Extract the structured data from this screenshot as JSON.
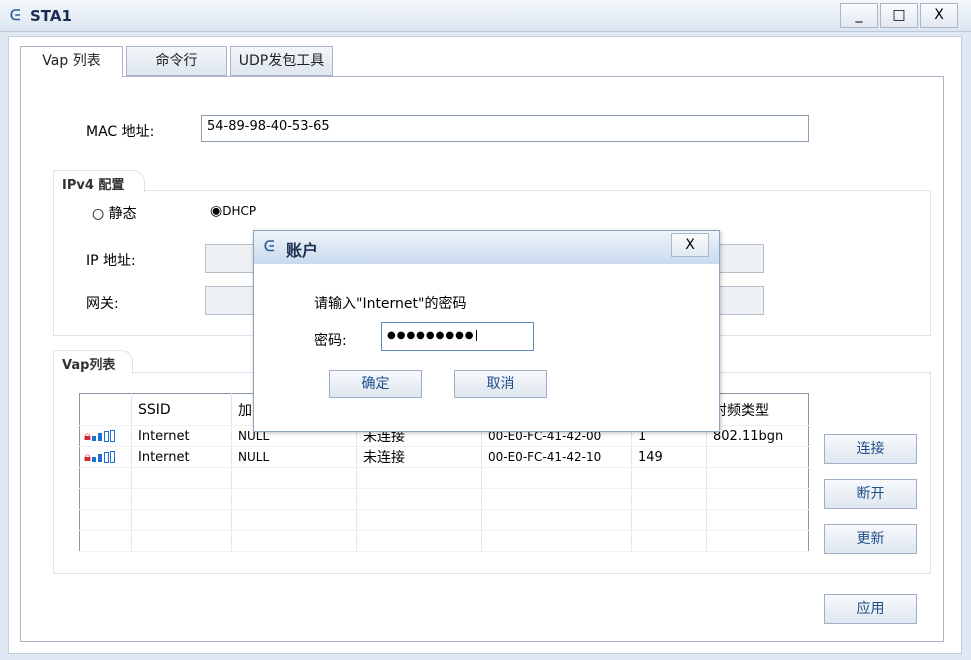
{
  "window": {
    "title": "STA1",
    "minimize": "_",
    "maximize": "□",
    "close": "X"
  },
  "tabs": [
    {
      "label": "Vap 列表",
      "active": true
    },
    {
      "label": "命令行"
    },
    {
      "label": "UDP发包工具"
    }
  ],
  "mac": {
    "label": "MAC 地址:",
    "value": "54-89-98-40-53-65"
  },
  "ipv4": {
    "title": "IPv4 配置",
    "static_label": "静态",
    "dhcp_label": "DHCP",
    "selected": "DHCP",
    "ip_label": "IP 地址:",
    "gateway_label": "网关:"
  },
  "vap": {
    "title": "Vap列表",
    "headers": [
      "",
      "SSID",
      "加",
      "",
      "",
      "",
      "射频类型"
    ],
    "rows": [
      {
        "ssid": "Internet",
        "enc": "NULL",
        "state": "未连接",
        "mac": "00-E0-FC-41-42-00",
        "channel": "1",
        "radio": "802.11bgn"
      },
      {
        "ssid": "Internet",
        "enc": "NULL",
        "state": "未连接",
        "mac": "00-E0-FC-41-42-10",
        "channel": "149",
        "radio": ""
      }
    ],
    "buttons": {
      "connect": "连接",
      "disconnect": "断开",
      "refresh": "更新"
    }
  },
  "apply": "应用",
  "dialog": {
    "title": "账户",
    "close": "X",
    "prompt": "请输入\"Internet\"的密码",
    "password_label": "密码:",
    "password_value": "●●●●●●●●●",
    "ok": "确定",
    "cancel": "取消"
  },
  "colors": {
    "accent": "#1f4e8c",
    "lock": "#d0283a",
    "signal": "#1e6fd0"
  }
}
